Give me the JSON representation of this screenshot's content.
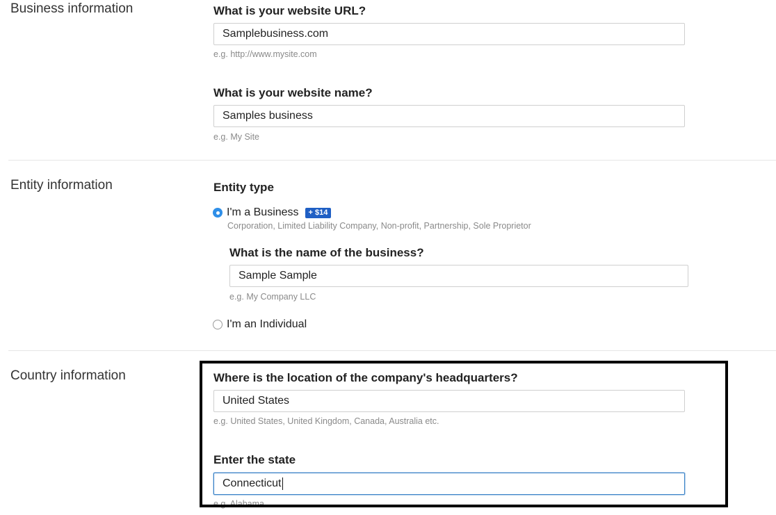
{
  "business_info": {
    "section_title": "Business information",
    "url_question": "What is your website URL?",
    "url_value": "Samplebusiness.com",
    "url_hint": "e.g. http://www.mysite.com",
    "name_question": "What is your website name?",
    "name_value": "Samples business",
    "name_hint": "e.g. My Site"
  },
  "entity_info": {
    "section_title": "Entity information",
    "entity_type_label": "Entity type",
    "business_option": {
      "label": "I'm a Business",
      "badge": "+ $14",
      "description": "Corporation, Limited Liability Company, Non-profit, Partnership, Sole Proprietor",
      "selected": true
    },
    "business_name_question": "What is the name of the business?",
    "business_name_value": "Sample Sample",
    "business_name_hint": "e.g. My Company LLC",
    "individual_option": {
      "label": "I'm an Individual",
      "selected": false
    }
  },
  "country_info": {
    "section_title": "Country information",
    "hq_question": "Where is the location of the company's headquarters?",
    "hq_value": "United States",
    "hq_hint": "e.g. United States, United Kingdom, Canada, Australia etc.",
    "state_question": "Enter the state",
    "state_value": "Connecticut",
    "state_hint": "e.g. Alabama"
  },
  "colors": {
    "radio_selected": "#2f8fe8",
    "badge_bg": "#1f5fc4",
    "focus_border": "#3b83c8",
    "highlight_border": "#000000"
  }
}
